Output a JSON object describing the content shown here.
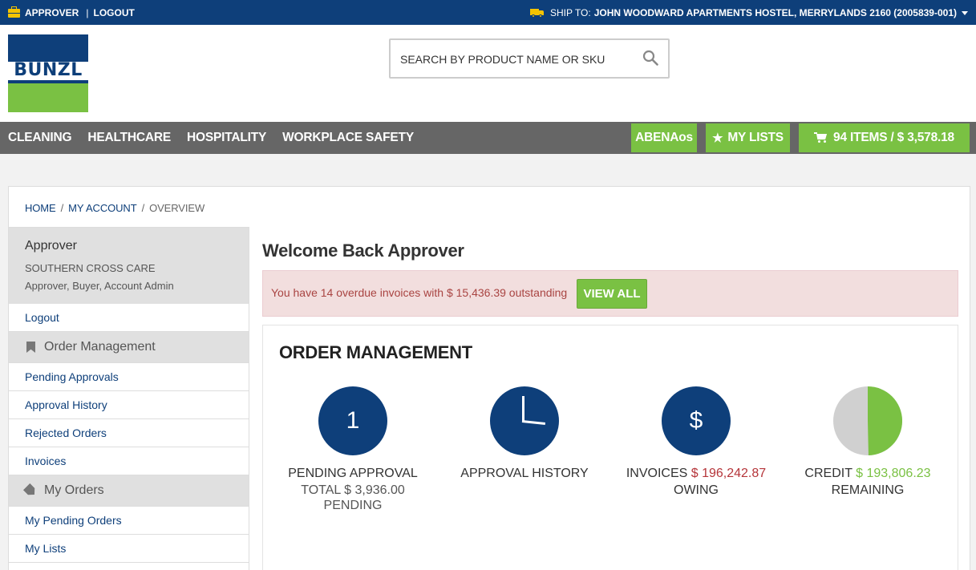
{
  "topbar": {
    "role": "APPROVER",
    "separator": "|",
    "logout": "LOGOUT",
    "ship_to_label": "SHIP TO:",
    "ship_to_value": "JOHN WOODWARD APARTMENTS HOSTEL, MERRYLANDS 2160 (2005839-001)"
  },
  "logo": {
    "text": "BUNZL"
  },
  "search": {
    "placeholder": "SEARCH BY PRODUCT NAME OR SKU"
  },
  "nav": {
    "categories": [
      "CLEANING",
      "HEALTHCARE",
      "HOSPITALITY",
      "WORKPLACE SAFETY"
    ],
    "abena": "ABENAos",
    "my_lists": "MY LISTS",
    "cart": "94 ITEMS / $ 3,578.18"
  },
  "breadcrumb": {
    "home": "HOME",
    "account": "MY ACCOUNT",
    "current": "OVERVIEW",
    "sep": "/"
  },
  "sidebar": {
    "user_name": "Approver",
    "org": "SOUTHERN CROSS CARE",
    "roles": "Approver, Buyer, Account Admin",
    "logout": "Logout",
    "order_management": "Order Management",
    "om_items": [
      "Pending Approvals",
      "Approval History",
      "Rejected Orders",
      "Invoices"
    ],
    "my_orders": "My Orders",
    "mo_items": [
      "My Pending Orders",
      "My Lists"
    ]
  },
  "main": {
    "welcome": "Welcome Back Approver",
    "alert": "You have 14 overdue invoices with $ 15,436.39 outstanding",
    "view_all": "VIEW ALL",
    "om_title": "ORDER MANAGEMENT",
    "pending": {
      "count": "1",
      "label": "PENDING APPROVAL",
      "total": "TOTAL $ 3,936.00",
      "status": "PENDING"
    },
    "history": {
      "label": "APPROVAL HISTORY"
    },
    "invoices": {
      "symbol": "$",
      "label": "INVOICES",
      "amount": "$ 196,242.87",
      "status": "OWING"
    },
    "credit": {
      "label": "CREDIT",
      "amount": "$ 193,806.23",
      "status": "REMAINING",
      "remaining_fraction": 0.4965
    }
  },
  "colors": {
    "brand_blue": "#0e3f7a",
    "brand_green": "#7ac143",
    "nav_gray": "#666666",
    "alert_text": "#a94442"
  },
  "icons": [
    "briefcase-icon",
    "truck-icon",
    "search-icon",
    "star-icon",
    "cart-icon",
    "bookmark-icon",
    "tag-icon",
    "clock-icon"
  ]
}
